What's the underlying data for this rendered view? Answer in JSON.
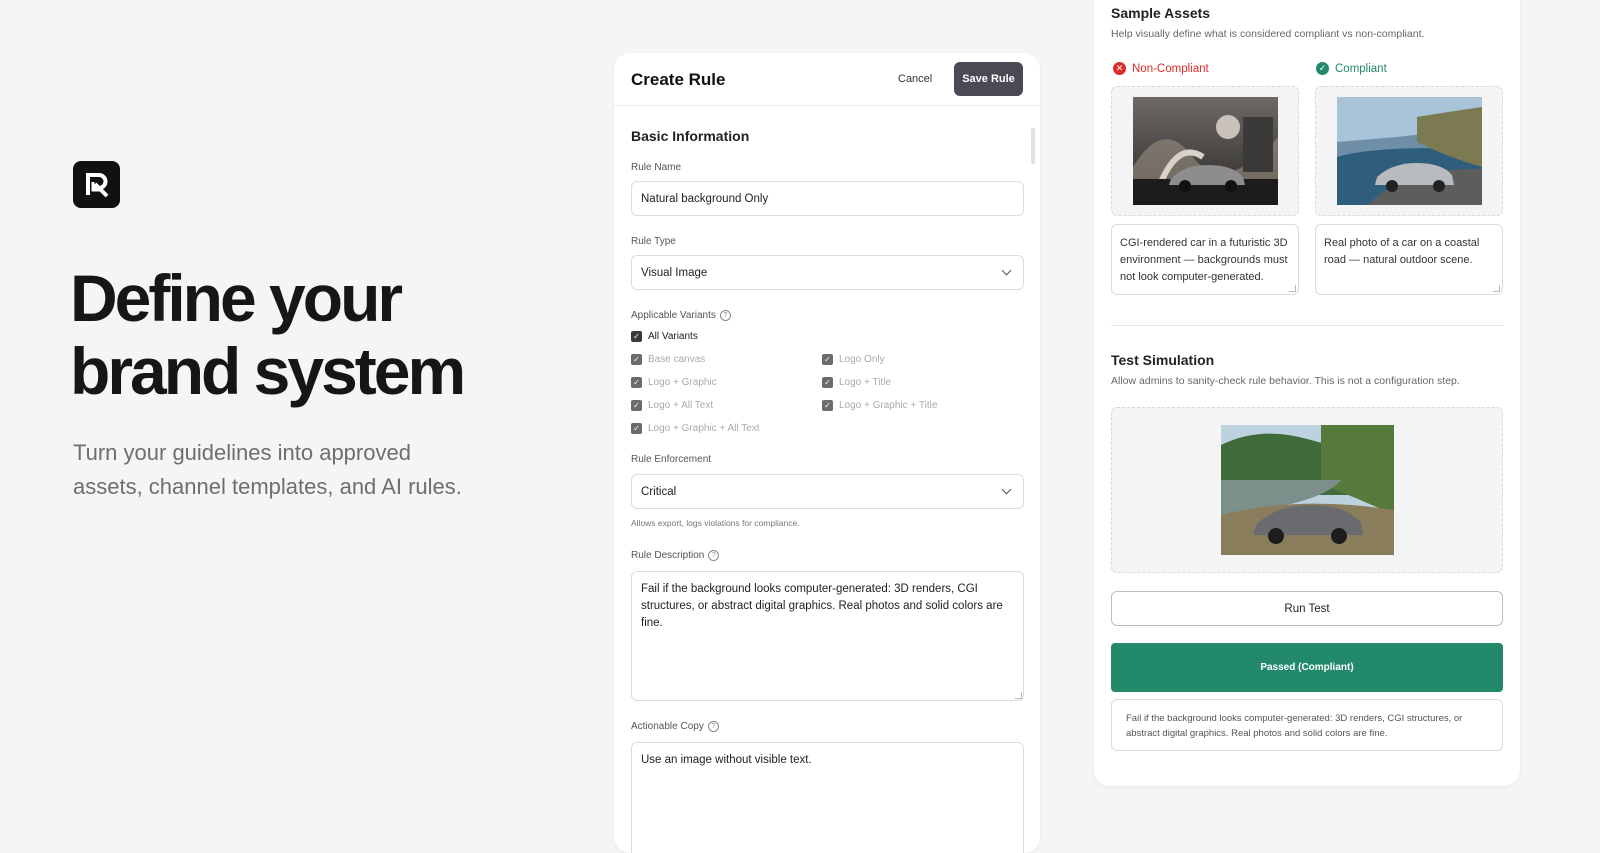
{
  "hero": {
    "headline_line1": "Define your",
    "headline_line2": "brand system",
    "sub_line1": "Turn your guidelines into approved",
    "sub_line2": "assets, channel templates, and AI rules."
  },
  "create_rule": {
    "title": "Create Rule",
    "cancel_label": "Cancel",
    "save_label": "Save Rule",
    "section_title": "Basic Information",
    "rule_name": {
      "label": "Rule Name",
      "value": "Natural background Only"
    },
    "rule_type": {
      "label": "Rule Type",
      "value": "Visual Image"
    },
    "variants": {
      "label": "Applicable Variants",
      "all": "All Variants",
      "items": [
        "Base canvas",
        "Logo Only",
        "Logo + Graphic",
        "Logo + Title",
        "Logo + All Text",
        "Logo + Graphic + Title",
        "Logo + Graphic + All Text"
      ]
    },
    "enforcement": {
      "label": "Rule Enforcement",
      "value": "Critical",
      "hint": "Allows export, logs violations for compliance."
    },
    "description": {
      "label": "Rule Description",
      "value": "Fail if the background looks computer-generated: 3D renders, CGI structures, or abstract digital graphics. Real photos and solid colors are fine."
    },
    "actionable_copy": {
      "label": "Actionable Copy",
      "value": "Use an image without visible text."
    }
  },
  "sample_assets": {
    "title": "Sample Assets",
    "subtitle": "Help visually define what is considered compliant vs non-compliant.",
    "non_compliant": {
      "label": "Non-Compliant",
      "caption": "CGI-rendered car in a futuristic 3D environment — backgrounds must not look computer-generated."
    },
    "compliant": {
      "label": "Compliant",
      "caption": "Real photo of a car on a coastal road — natural outdoor scene."
    }
  },
  "test_simulation": {
    "title": "Test Simulation",
    "subtitle": "Allow admins to sanity-check rule behavior. This is not a configuration step.",
    "run_label": "Run Test",
    "result_label": "Passed (Compliant)",
    "result_text": "Fail if the background looks computer-generated: 3D renders, CGI structures, or abstract digital graphics. Real photos and solid colors are fine."
  },
  "colors": {
    "accent_dark": "#4a4a55",
    "error_red": "#d92d2d",
    "success_green": "#23896b"
  }
}
